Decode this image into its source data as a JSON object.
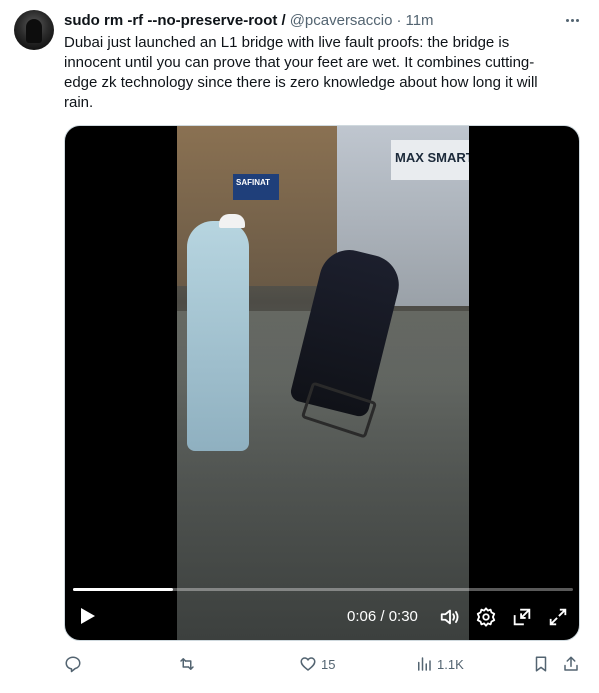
{
  "tweet": {
    "author_name": "sudo rm -rf --no-preserve-root /",
    "handle": "@pcaversaccio",
    "separator": "·",
    "time": "11m",
    "text": "Dubai just launched an L1 bridge with live fault proofs: the bridge is innocent until you can prove that your feet are wet. It combines cutting-edge zk technology since there is zero knowledge about how long it will rain."
  },
  "video": {
    "sign_text_1": "MAX SMART",
    "sign_text_2": "SAFINAT",
    "time_display": "0:06 / 0:30",
    "progress": 0.2
  },
  "actions": {
    "reply_count": "",
    "repost_count": "",
    "like_count": "15",
    "views_count": "1.1K"
  },
  "icons": {
    "more": "more-horizontal-icon",
    "reply": "reply-icon",
    "repost": "repost-icon",
    "like": "heart-icon",
    "views": "views-chart-icon",
    "bookmark": "bookmark-icon",
    "share": "share-icon",
    "play": "play-icon",
    "volume": "volume-icon",
    "settings": "gear-icon",
    "pip": "picture-in-picture-icon",
    "fullscreen": "fullscreen-icon"
  },
  "colors": {
    "text": "#0f1419",
    "secondary": "#536471",
    "video_bg": "#000000"
  }
}
